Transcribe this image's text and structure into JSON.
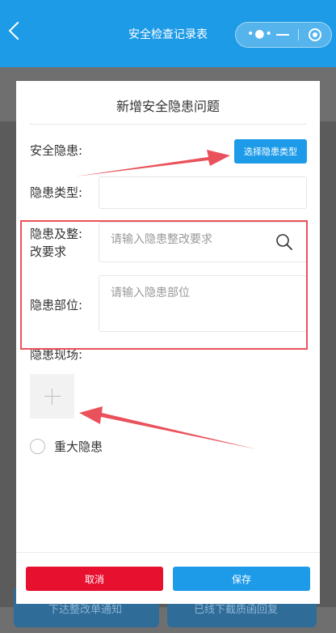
{
  "header": {
    "title": "安全检查记录表",
    "more_glyph": "•●•"
  },
  "background": {
    "button1": "下达整改单通知",
    "button2": "已线下截质函回复"
  },
  "modal": {
    "title": "新增安全隐患问题",
    "hazard_label": "安全隐患:",
    "select_type_button": "选择隐患类型",
    "hazard_type_label": "隐患类型:",
    "hazard_type_value": "",
    "rectification_label_line1": "隐患及整:",
    "rectification_label_line2": "改要求",
    "rectification_placeholder": "请输入隐患整改要求",
    "location_label": "隐患部位:",
    "location_placeholder": "请输入隐患部位",
    "scene_label": "隐患现场:",
    "major_hazard_label": "重大隐患",
    "cancel_button": "取消",
    "save_button": "保存"
  },
  "colors": {
    "header": "#1e9be7",
    "primary": "#1d9be9",
    "danger": "#e8102f",
    "annotation": "#e9525b"
  }
}
